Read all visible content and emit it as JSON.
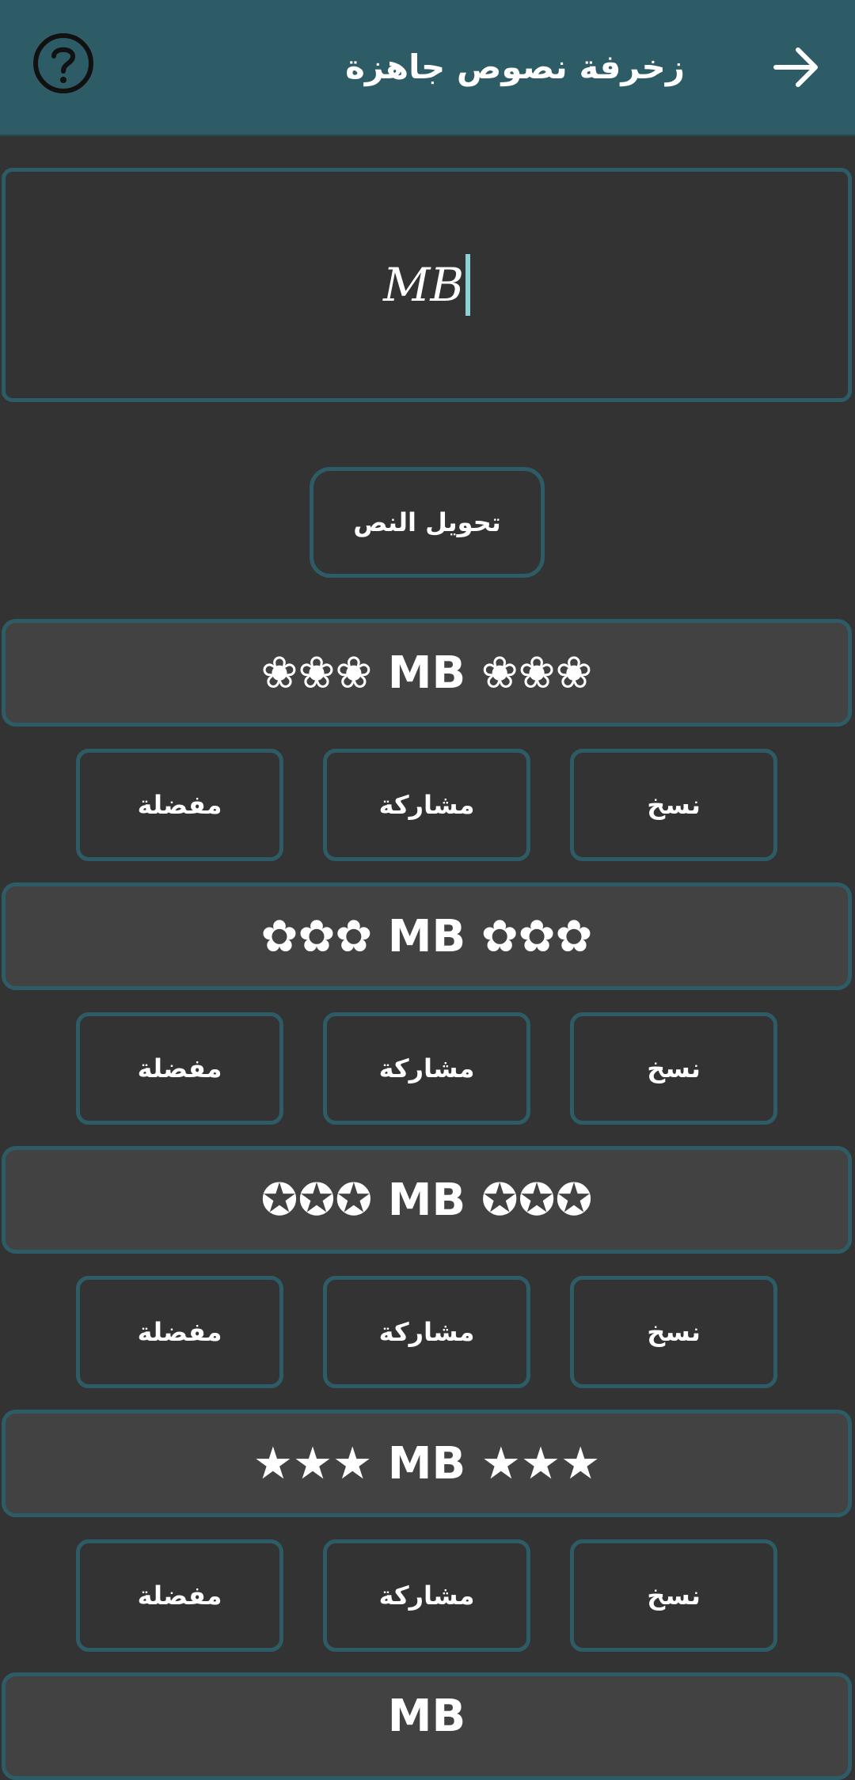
{
  "app_bar": {
    "title": "زخرفة نصوص جاهزة",
    "help_icon": "help-circle-icon",
    "back_icon": "arrow-forward-icon"
  },
  "input": {
    "value": "MB"
  },
  "convert_button": {
    "label": "تحويل النص"
  },
  "results": [
    {
      "text": "❀❀❀ MB ❀❀❀",
      "actions": {
        "copy": "نسخ",
        "share": "مشاركة",
        "favorite": "مفضلة"
      }
    },
    {
      "text": "✿✿✿ MB ✿✿✿",
      "actions": {
        "copy": "نسخ",
        "share": "مشاركة",
        "favorite": "مفضلة"
      }
    },
    {
      "text": "✪✪✪ MB ✪✪✪",
      "actions": {
        "copy": "نسخ",
        "share": "مشاركة",
        "favorite": "مفضلة"
      }
    },
    {
      "text": "★★★ MB ★★★",
      "actions": {
        "copy": "نسخ",
        "share": "مشاركة",
        "favorite": "مفضلة"
      }
    },
    {
      "text": "MB"
    }
  ],
  "colors": {
    "app_bar": "#2d5c66",
    "background": "#333333",
    "border_accent": "#2d5c66",
    "result_background": "#424242",
    "caret": "#8fd2d6",
    "text": "#ffffff"
  }
}
